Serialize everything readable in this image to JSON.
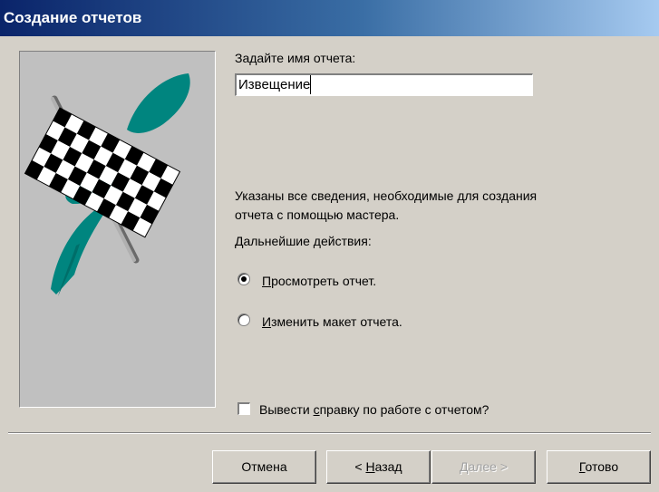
{
  "window": {
    "title": "Создание отчетов"
  },
  "form": {
    "name_prompt": "Задайте имя отчета:",
    "report_name": "Извещение",
    "info_line1": "Указаны все сведения, необходимые для создания",
    "info_line2": "отчета с помощью мастера.",
    "next_actions": "Дальнейшие действия:",
    "option_preview": {
      "accel": "П",
      "rest": "росмотреть отчет.",
      "selected": true
    },
    "option_modify": {
      "accel": "И",
      "rest": "зменить макет отчета.",
      "selected": false
    },
    "help_checkbox": {
      "before": "Вывести ",
      "accel": "с",
      "after": "правку по работе с отчетом?",
      "checked": false
    }
  },
  "buttons": {
    "cancel": "Отмена",
    "back": {
      "prefix": "< ",
      "accel": "Н",
      "rest": "азад"
    },
    "next": {
      "accel": "Д",
      "rest": "алее >",
      "enabled": false
    },
    "finish": {
      "accel": "Г",
      "rest": "отово"
    }
  },
  "colors": {
    "flag_swoosh": "#00857f",
    "title_bar": "#0a246a",
    "dialog_face": "#d4d0c8"
  },
  "icons": {
    "wizard_art": "checkered-flag-icon"
  }
}
